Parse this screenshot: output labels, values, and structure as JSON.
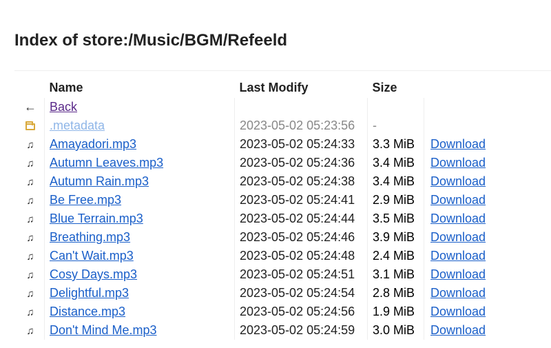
{
  "page": {
    "title": "Index of store:/Music/BGM/Refeeld"
  },
  "table": {
    "headers": {
      "name": "Name",
      "modified": "Last Modify",
      "size": "Size"
    },
    "back": {
      "icon": "←",
      "label": "Back"
    },
    "folder": {
      "icon": "folder-icon",
      "name": ".metadata",
      "modified": "2023-05-02 05:23:56",
      "size": "-"
    },
    "download_label": "Download",
    "file_icon": "♫",
    "files": [
      {
        "name": "Amayadori.mp3",
        "modified": "2023-05-02 05:24:33",
        "size": "3.3 MiB"
      },
      {
        "name": "Autumn Leaves.mp3",
        "modified": "2023-05-02 05:24:36",
        "size": "3.4 MiB"
      },
      {
        "name": "Autumn Rain.mp3",
        "modified": "2023-05-02 05:24:38",
        "size": "3.4 MiB"
      },
      {
        "name": "Be Free.mp3",
        "modified": "2023-05-02 05:24:41",
        "size": "2.9 MiB"
      },
      {
        "name": "Blue Terrain.mp3",
        "modified": "2023-05-02 05:24:44",
        "size": "3.5 MiB"
      },
      {
        "name": "Breathing.mp3",
        "modified": "2023-05-02 05:24:46",
        "size": "3.9 MiB"
      },
      {
        "name": "Can't Wait.mp3",
        "modified": "2023-05-02 05:24:48",
        "size": "2.4 MiB"
      },
      {
        "name": "Cosy Days.mp3",
        "modified": "2023-05-02 05:24:51",
        "size": "3.1 MiB"
      },
      {
        "name": "Delightful.mp3",
        "modified": "2023-05-02 05:24:54",
        "size": "2.8 MiB"
      },
      {
        "name": "Distance.mp3",
        "modified": "2023-05-02 05:24:56",
        "size": "1.9 MiB"
      },
      {
        "name": "Don't Mind Me.mp3",
        "modified": "2023-05-02 05:24:59",
        "size": "3.0 MiB"
      }
    ]
  }
}
